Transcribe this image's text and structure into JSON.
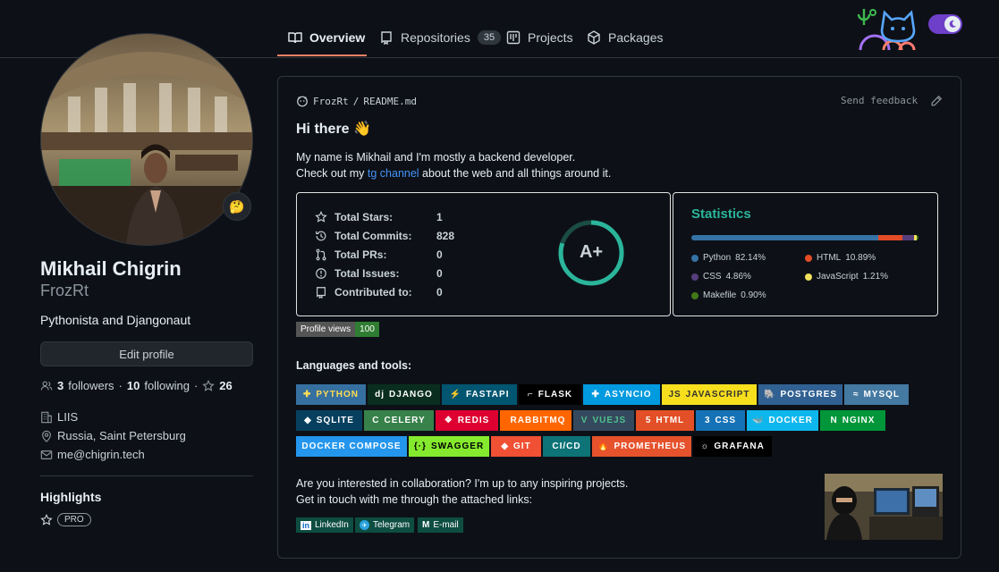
{
  "nav": {
    "tabs": [
      {
        "label": "Overview"
      },
      {
        "label": "Repositories",
        "count": "35"
      },
      {
        "label": "Projects"
      },
      {
        "label": "Packages"
      }
    ]
  },
  "profile": {
    "name": "Mikhail Chigrin",
    "login": "FrozRt",
    "bio": "Pythonista and Djangonaut",
    "edit_label": "Edit profile",
    "followers_count": "3",
    "followers_label": "followers",
    "following_count": "10",
    "following_label": "following",
    "stars_count": "26",
    "company": "LIIS",
    "location": "Russia, Saint Petersburg",
    "email": "me@chigrin.tech",
    "highlights_title": "Highlights",
    "pro_label": "PRO",
    "status_emoji": "🤔"
  },
  "readme": {
    "owner": "FrozRt",
    "separator": "/",
    "file": "README.md",
    "feedback": "Send feedback",
    "greeting": "Hi there 👋",
    "intro_line1": "My name is Mikhail and I'm mostly a backend developer.",
    "intro_line2_pre": "Check out my ",
    "intro_link": "tg channel",
    "intro_line2_post": " about the web and all things around it.",
    "views_label": "Profile views",
    "views_count": "100",
    "tools_title": "Languages and tools:",
    "collab_line1": "Are you interested in collaboration? I'm up to any inspiring projects.",
    "collab_line2": "Get in touch with me through the attached links:"
  },
  "stats": {
    "rows": [
      {
        "label": "Total Stars:",
        "value": "1",
        "icon": "star-icon"
      },
      {
        "label": "Total Commits:",
        "value": "828",
        "icon": "history-icon"
      },
      {
        "label": "Total PRs:",
        "value": "0",
        "icon": "pull-request-icon"
      },
      {
        "label": "Total Issues:",
        "value": "0",
        "icon": "issue-icon"
      },
      {
        "label": "Contributed to:",
        "value": "0",
        "icon": "repo-icon"
      }
    ],
    "grade": "A+",
    "grade_progress": 0.8
  },
  "languages": {
    "title": "Statistics",
    "items": [
      {
        "name": "Python",
        "pct": "82.14%",
        "value": 82.14,
        "color": "#3572A5"
      },
      {
        "name": "HTML",
        "pct": "10.89%",
        "value": 10.89,
        "color": "#e34c26"
      },
      {
        "name": "CSS",
        "pct": "4.86%",
        "value": 4.86,
        "color": "#563d7c"
      },
      {
        "name": "JavaScript",
        "pct": "1.21%",
        "value": 1.21,
        "color": "#f1e05a"
      },
      {
        "name": "Makefile",
        "pct": "0.90%",
        "value": 0.9,
        "color": "#427819"
      }
    ]
  },
  "badges": [
    {
      "label": "PYTHON",
      "bg": "#3670A0",
      "fg": "#ffdd54",
      "glyph": "✚"
    },
    {
      "label": "DJANGO",
      "bg": "#092E20",
      "fg": "#ffffff",
      "glyph": "dj"
    },
    {
      "label": "FASTAPI",
      "bg": "#005571",
      "fg": "#ffffff",
      "glyph": "⚡"
    },
    {
      "label": "FLASK",
      "bg": "#000000",
      "fg": "#ffffff",
      "glyph": "⌐"
    },
    {
      "label": "ASYNCIO",
      "bg": "#009ADF",
      "fg": "#ffffff",
      "glyph": "✚"
    },
    {
      "label": "JAVASCRIPT",
      "bg": "#F7DF1E",
      "fg": "#323330",
      "glyph": "JS"
    },
    {
      "label": "POSTGRES",
      "bg": "#316192",
      "fg": "#ffffff",
      "glyph": "🐘"
    },
    {
      "label": "MYSQL",
      "bg": "#4479A1",
      "fg": "#ffffff",
      "glyph": "≈"
    },
    {
      "label": "SQLITE",
      "bg": "#07405E",
      "fg": "#ffffff",
      "glyph": "◆"
    },
    {
      "label": "CELERY",
      "bg": "#37814A",
      "fg": "#ffffff",
      "glyph": "C"
    },
    {
      "label": "REDIS",
      "bg": "#DD0031",
      "fg": "#ffffff",
      "glyph": "❖"
    },
    {
      "label": "RABBITMQ",
      "bg": "#FF6600",
      "fg": "#ffffff",
      "glyph": ""
    },
    {
      "label": "VUEJS",
      "bg": "#35495E",
      "fg": "#4FC08D",
      "glyph": "V"
    },
    {
      "label": "HTML",
      "bg": "#E34F26",
      "fg": "#ffffff",
      "glyph": "5"
    },
    {
      "label": "CSS",
      "bg": "#1572B6",
      "fg": "#ffffff",
      "glyph": "3"
    },
    {
      "label": "DOCKER",
      "bg": "#0DB7ED",
      "fg": "#ffffff",
      "glyph": "🐳"
    },
    {
      "label": "NGINX",
      "bg": "#009639",
      "fg": "#ffffff",
      "glyph": "N"
    },
    {
      "label": "DOCKER COMPOSE",
      "bg": "#2496ED",
      "fg": "#ffffff",
      "glyph": ""
    },
    {
      "label": "SWAGGER",
      "bg": "#85EA2D",
      "fg": "#000000",
      "glyph": "{·}"
    },
    {
      "label": "GIT",
      "bg": "#F05033",
      "fg": "#ffffff",
      "glyph": "◆"
    },
    {
      "label": "CI/CD",
      "bg": "#0D7377",
      "fg": "#ffffff",
      "glyph": ""
    },
    {
      "label": "PROMETHEUS",
      "bg": "#E6522C",
      "fg": "#ffffff",
      "glyph": "🔥"
    },
    {
      "label": "GRAFANA",
      "bg": "#000000",
      "fg": "#ffffff",
      "glyph": "☼"
    }
  ],
  "links": [
    {
      "label": "LinkedIn",
      "bg": "#0e4d42",
      "glyph": "in"
    },
    {
      "label": "Telegram",
      "bg": "#0e4d42",
      "glyph": "✈"
    },
    {
      "label": "E-mail",
      "bg": "#0e4d42",
      "glyph": "M"
    }
  ]
}
